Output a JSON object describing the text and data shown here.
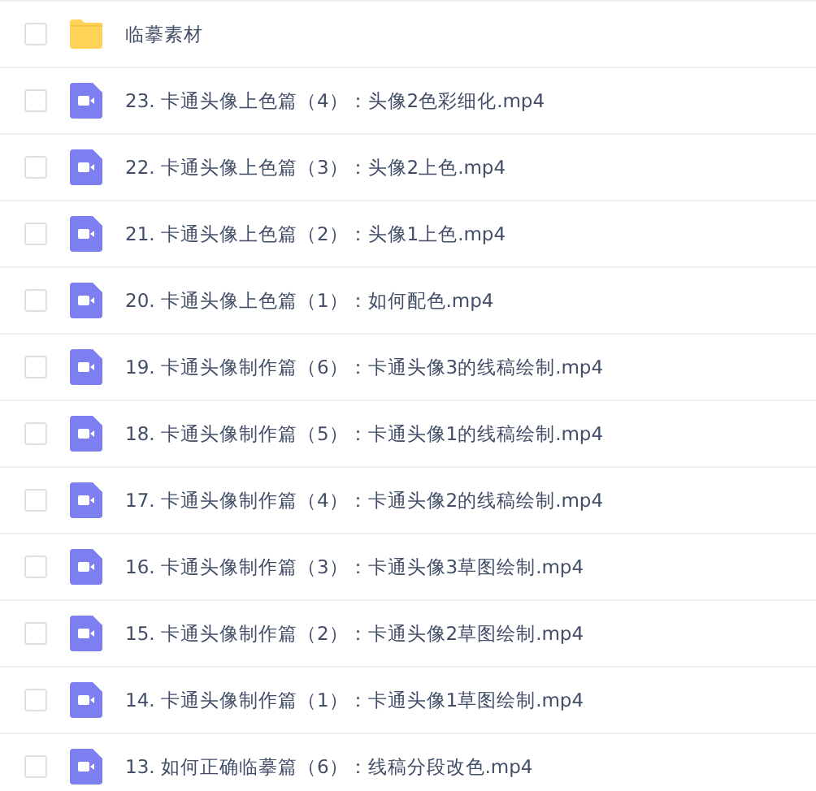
{
  "files": [
    {
      "kind": "folder",
      "name": "临摹素材",
      "checked": false
    },
    {
      "kind": "video",
      "name": "23. 卡通头像上色篇（4）：头像2色彩细化.mp4",
      "checked": false
    },
    {
      "kind": "video",
      "name": "22. 卡通头像上色篇（3）：头像2上色.mp4",
      "checked": false
    },
    {
      "kind": "video",
      "name": "21. 卡通头像上色篇（2）：头像1上色.mp4",
      "checked": false
    },
    {
      "kind": "video",
      "name": "20. 卡通头像上色篇（1）：如何配色.mp4",
      "checked": false
    },
    {
      "kind": "video",
      "name": "19. 卡通头像制作篇（6）：卡通头像3的线稿绘制.mp4",
      "checked": false
    },
    {
      "kind": "video",
      "name": "18. 卡通头像制作篇（5）：卡通头像1的线稿绘制.mp4",
      "checked": false
    },
    {
      "kind": "video",
      "name": "17. 卡通头像制作篇（4）：卡通头像2的线稿绘制.mp4",
      "checked": false
    },
    {
      "kind": "video",
      "name": "16. 卡通头像制作篇（3）：卡通头像3草图绘制.mp4",
      "checked": false
    },
    {
      "kind": "video",
      "name": "15. 卡通头像制作篇（2）：卡通头像2草图绘制.mp4",
      "checked": false
    },
    {
      "kind": "video",
      "name": "14. 卡通头像制作篇（1）：卡通头像1草图绘制.mp4",
      "checked": false
    },
    {
      "kind": "video",
      "name": "13. 如何正确临摹篇（6）：线稿分段改色.mp4",
      "checked": false
    }
  ]
}
